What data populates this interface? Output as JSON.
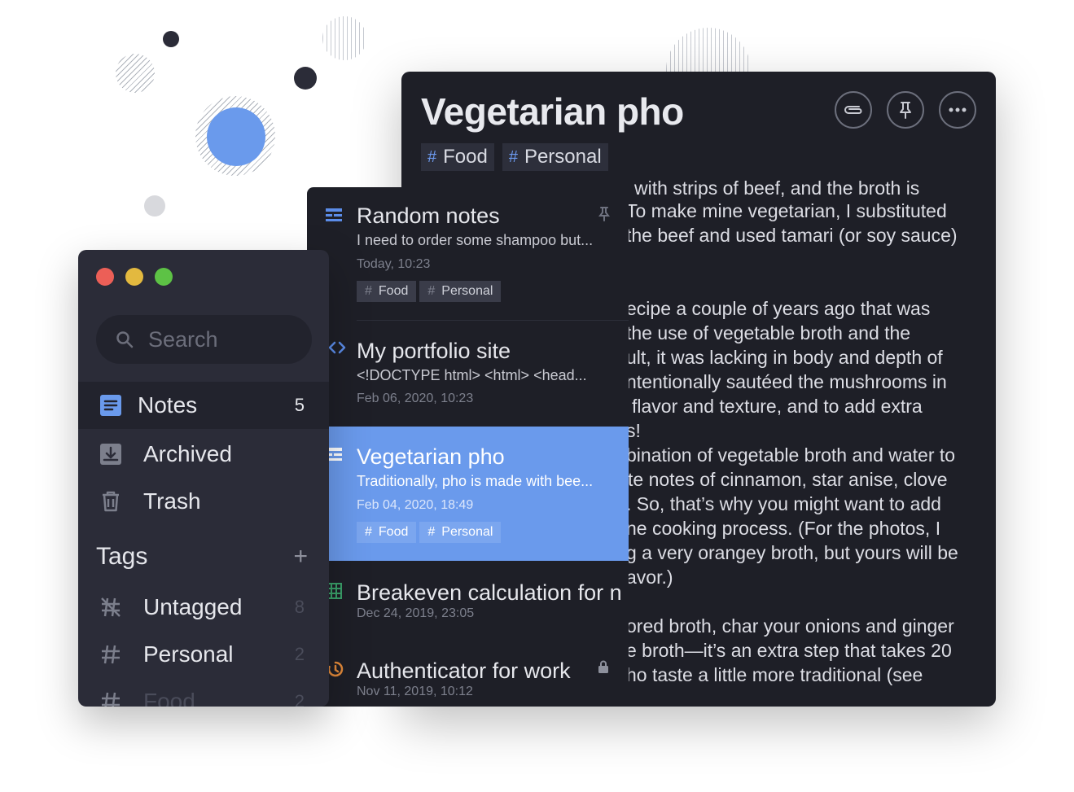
{
  "editor": {
    "title": "Vegetarian pho",
    "tags": [
      "Food",
      "Personal"
    ],
    "actions": [
      {
        "name": "attachment-icon"
      },
      {
        "name": "pin-icon"
      },
      {
        "name": "more-icon"
      }
    ],
    "body_lines": [
      "with strips of beef, and the broth is",
      "To make mine vegetarian, I substituted",
      "the beef and used tamari (or soy sauce)",
      "",
      "ecipe a couple of years ago that was",
      "the use of vegetable broth and the",
      "ult, it was lacking in body and depth of",
      "ntentionally sautéed the mushrooms in",
      "flavor and texture, and to add extra",
      "s!",
      "bination of vegetable broth and water to",
      "te notes of cinnamon, star anise, clove",
      ". So, that’s why you might want to add",
      "ne cooking process. (For the photos, I",
      "g a very orangey broth, but yours will be",
      "avor.)",
      "",
      "ored broth, char your onions and ginger",
      "e broth—it’s an extra step that takes 20",
      "ho taste a little more traditional (see"
    ]
  },
  "notes": [
    {
      "title": "Random notes",
      "preview": "I need to order some shampoo but...",
      "date": "Today, 10:23",
      "tags": [
        "Food",
        "Personal"
      ],
      "icon": "note-icon"
    },
    {
      "title": "My portfolio site",
      "preview": "<!DOCTYPE html> <html> <head...",
      "date": "Feb 06, 2020, 10:23",
      "tags": [],
      "icon": "code-icon"
    },
    {
      "title": "Vegetarian pho",
      "preview": "Traditionally, pho is made with bee...",
      "date": "Feb 04, 2020, 18:49",
      "tags": [
        "Food",
        "Personal"
      ],
      "icon": "note-icon"
    },
    {
      "title": "Breakeven calculation for n",
      "preview": "",
      "date": "Dec 24, 2019, 23:05",
      "tags": [],
      "icon": "spreadsheet-icon"
    },
    {
      "title": "Authenticator for work",
      "preview": "",
      "date": "Nov 11, 2019, 10:12",
      "tags": [],
      "icon": "authenticator-icon"
    }
  ],
  "sidebar": {
    "search_placeholder": "Search",
    "items": [
      {
        "label": "Notes",
        "count": "5"
      },
      {
        "label": "Archived",
        "count": ""
      },
      {
        "label": "Trash",
        "count": ""
      }
    ],
    "tags_heading": "Tags",
    "tags_add": "+",
    "tags": [
      {
        "label": "Untagged",
        "count": "8"
      },
      {
        "label": "Personal",
        "count": "2"
      },
      {
        "label": "Food",
        "count": "2"
      }
    ]
  },
  "colors": {
    "accent": "#6a9aec",
    "window_dark": "#1e1f27",
    "sidebar_bg": "#2b2c38",
    "traffic_red": "#ec5f57",
    "traffic_yellow": "#e3b93f",
    "traffic_green": "#5dc245"
  }
}
